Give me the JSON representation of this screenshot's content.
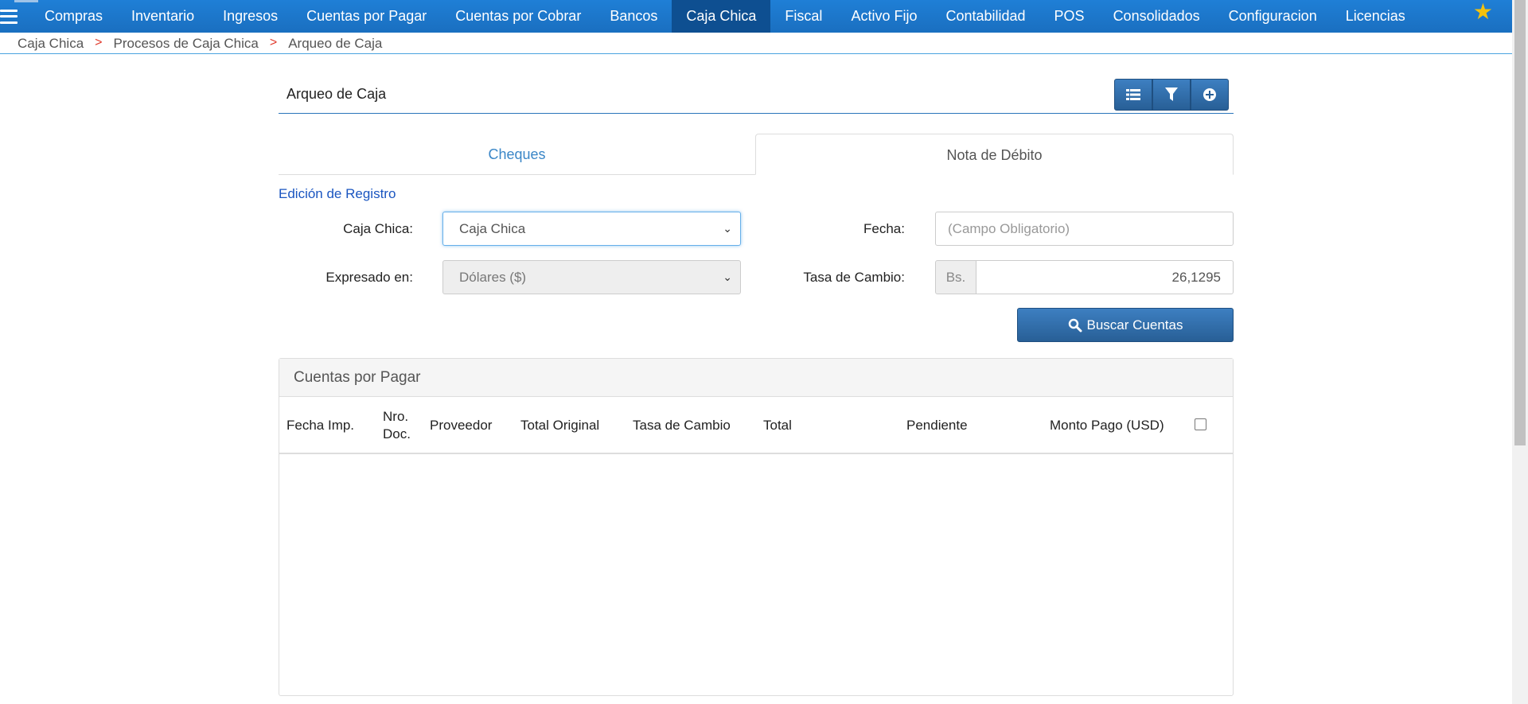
{
  "nav": {
    "items": [
      "Compras",
      "Inventario",
      "Ingresos",
      "Cuentas por Pagar",
      "Cuentas por Cobrar",
      "Bancos",
      "Caja Chica",
      "Fiscal",
      "Activo Fijo",
      "Contabilidad",
      "POS",
      "Consolidados",
      "Configuracion",
      "Licencias"
    ],
    "active": "Caja Chica",
    "menu_icon": "hamburger-icon",
    "favorite_icon": "star-icon"
  },
  "breadcrumb": [
    "Caja Chica",
    "Procesos de Caja Chica",
    "Arqueo de Caja"
  ],
  "page": {
    "title": "Arqueo de Caja",
    "toolbar_icons": [
      "list-icon",
      "filter-icon",
      "plus-circle-icon"
    ]
  },
  "tabs": [
    {
      "label": "Cheques",
      "active": false
    },
    {
      "label": "Nota de Débito",
      "active": true
    }
  ],
  "form": {
    "section_title": "Edición de Registro",
    "caja_chica_label": "Caja Chica:",
    "caja_chica_value": "Caja Chica",
    "fecha_label": "Fecha:",
    "fecha_placeholder": "(Campo Obligatorio)",
    "expresado_label": "Expresado en:",
    "expresado_value": "Dólares ($)",
    "tasa_label": "Tasa de Cambio:",
    "tasa_prefix": "Bs.",
    "tasa_value": "26,1295",
    "search_button": "Buscar Cuentas"
  },
  "table": {
    "title": "Cuentas por Pagar",
    "columns": [
      "Fecha Imp.",
      "Nro. Doc.",
      "Proveedor",
      "Total Original",
      "Tasa de Cambio",
      "Total",
      "Pendiente",
      "Monto Pago (USD)"
    ],
    "rows": []
  },
  "colors": {
    "nav_bg": "#1a6fc0",
    "nav_active": "#0e4f91",
    "accent": "#2a75bb",
    "breadcrumb_separator": "#e0392b"
  }
}
